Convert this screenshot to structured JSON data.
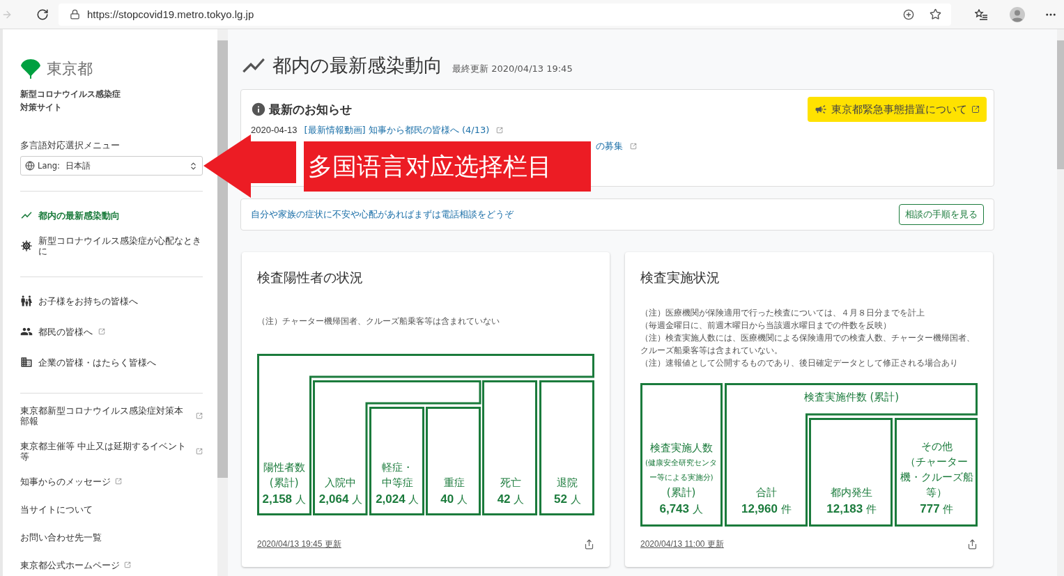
{
  "browser": {
    "url": "https://stopcovid19.metro.tokyo.lg.jp"
  },
  "sidebar": {
    "logo_text": "東京都",
    "site_title_lines": [
      "新型コロナウイルス感染症",
      "対策サイト"
    ],
    "language_label": "多言語対応選択メニュー",
    "language_select": {
      "prefix": "Lang:",
      "value": "日本語"
    },
    "nav_groups": [
      [
        {
          "label": "都内の最新感染動向",
          "kind": "trend",
          "selected": true,
          "external": false
        },
        {
          "label": "新型コロナウイルス感染症が心配なときに",
          "kind": "virus",
          "selected": false,
          "external": false
        }
      ],
      [
        {
          "label": "お子様をお持ちの皆様へ",
          "kind": "family",
          "selected": false,
          "external": false
        },
        {
          "label": "都民の皆様へ",
          "kind": "people",
          "selected": false,
          "external": true
        },
        {
          "label": "企業の皆様・はたらく皆様へ",
          "kind": "building",
          "selected": false,
          "external": false
        }
      ],
      [
        {
          "label": "東京都新型コロナウイルス感染症対策本部報",
          "kind": "text",
          "selected": false,
          "external": true
        },
        {
          "label": "東京都主催等 中止又は延期するイベント等",
          "kind": "text",
          "selected": false,
          "external": true
        },
        {
          "label": "知事からのメッセージ",
          "kind": "text",
          "selected": false,
          "external": true
        },
        {
          "label": "当サイトについて",
          "kind": "text",
          "selected": false,
          "external": false
        },
        {
          "label": "お問い合わせ先一覧",
          "kind": "text",
          "selected": false,
          "external": false
        },
        {
          "label": "東京都公式ホームページ",
          "kind": "text",
          "selected": false,
          "external": true
        }
      ]
    ]
  },
  "main": {
    "title": "都内の最新感染動向",
    "last_updated": "最終更新 2020/04/13 19:45",
    "news": {
      "heading": "最新のお知らせ",
      "emergency_button": "東京都緊急事態措置について",
      "items": [
        {
          "kind": "full",
          "date": "2020-04-13",
          "link": "[最新情報動画] 知事から都民の皆様へ (4/13)"
        },
        {
          "kind": "covered",
          "link": "の募集"
        }
      ]
    },
    "consult": {
      "text": "自分や家族の症状に不安や心配があればまずは電話相談をどうぞ",
      "button": "相談の手順を見る"
    },
    "cards": [
      {
        "kind": "positive",
        "title": "検査陽性者の状況",
        "notes": [
          "（注）チャーター機帰国者、クルーズ船乗客等は含まれていない"
        ],
        "boxes": [
          {
            "label": [
              "陽性者数",
              "(累計)"
            ],
            "value": "2,158",
            "unit": "人"
          },
          {
            "label": [
              "入院中"
            ],
            "value": "2,064",
            "unit": "人"
          },
          {
            "label": [
              "軽症・",
              "中等症"
            ],
            "value": "2,024",
            "unit": "人"
          },
          {
            "label": [
              "重症"
            ],
            "value": "40",
            "unit": "人"
          },
          {
            "label": [
              "死亡"
            ],
            "value": "42",
            "unit": "人"
          },
          {
            "label": [
              "退院"
            ],
            "value": "52",
            "unit": "人"
          }
        ],
        "updated": "2020/04/13 19:45 更新"
      },
      {
        "kind": "tests",
        "title": "検査実施状況",
        "notes": [
          "（注）医療機関が保険適用で行った検査については、４月８日分までを計上",
          "（毎週金曜日に、前週木曜日から当該週水曜日までの件数を反映）",
          "（注）検査実施人数には、医療機関による保険適用での検査人数、チャーター機帰国者、クルーズ船乗客等は含まれていない。",
          "（注）速報値として公開するものであり、後日確定データとして修正される場合あり"
        ],
        "group_label": "検査実施件数 (累計)",
        "boxes": [
          {
            "label": [
              "検査実施人数"
            ],
            "note": "(健康安全研究センター等による実施分)",
            "label_after": "(累計)",
            "value": "6,743",
            "unit": "人"
          },
          {
            "label": [
              "合計"
            ],
            "value": "12,960",
            "unit": "件"
          },
          {
            "label": [
              "都内発生"
            ],
            "value": "12,183",
            "unit": "件"
          },
          {
            "label": [
              "その他",
              "（チャーター機・クルーズ船等）"
            ],
            "value": "777",
            "unit": "件"
          }
        ],
        "updated": "2020/04/13 11:00 更新"
      }
    ]
  },
  "annotation": {
    "text": "多国语言对应选择栏目"
  }
}
